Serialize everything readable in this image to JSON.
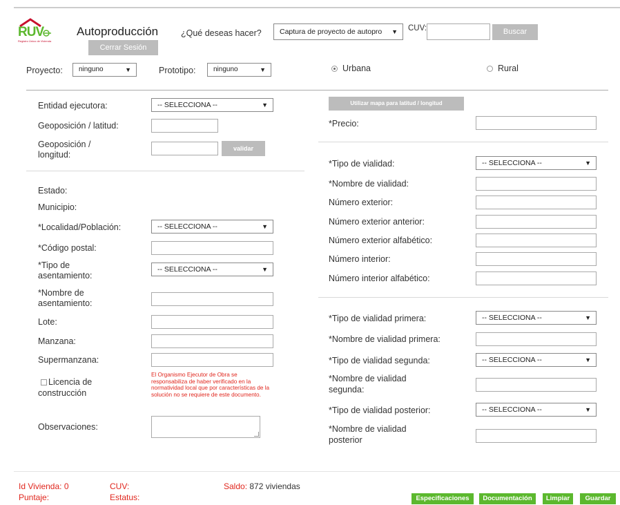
{
  "header": {
    "logo_text": "RUV",
    "logo_subtitle": "Registro Único de Vivienda",
    "title": "Autoproducción",
    "question": "¿Qué deseas hacer?",
    "action_select": "Captura de proyecto de autopro",
    "cuv_label": "CUV:",
    "cuv_value": "",
    "buscar": "Buscar",
    "cerrar_sesion": "Cerrar Sesión"
  },
  "filters": {
    "proyecto_label": "Proyecto:",
    "proyecto_value": "ninguno",
    "prototipo_label": "Prototipo:",
    "prototipo_value": "ninguno",
    "urbana": "Urbana",
    "rural": "Rural"
  },
  "left": {
    "entidad_label": "Entidad ejecutora:",
    "entidad_value": "-- SELECCIONA --",
    "latitud_label": "Geoposición / latitud:",
    "longitud_label_1": "Geoposición /",
    "longitud_label_2": "longitud:",
    "validar": "validar",
    "estado_label": "Estado:",
    "municipio_label": "Municipio:",
    "localidad_label": "*Localidad/Población:",
    "localidad_value": "-- SELECCIONA --",
    "cp_label": "*Código postal:",
    "tipo_asent_label_1": "*Tipo de",
    "tipo_asent_label_2": "asentamiento:",
    "tipo_asent_value": "-- SELECCIONA --",
    "nombre_asent_label_1": "*Nombre de",
    "nombre_asent_label_2": "asentamiento:",
    "lote_label": "Lote:",
    "manzana_label": "Manzana:",
    "supermanzana_label": "Supermanzana:",
    "licencia_label_1": "Licencia de",
    "licencia_label_2": "construcción",
    "licencia_note": [
      "El Organismo Ejecutor de Obra se",
      "responsabiliza de haber verificado en la",
      "normatividad local que por características de la",
      "solución no se requiere de este documento."
    ],
    "observaciones_label": "Observaciones:"
  },
  "right": {
    "mapa_button": "Utilizar mapa para latitud / longitud",
    "precio_label": "*Precio:",
    "tipo_vialidad_label": "*Tipo de vialidad:",
    "tipo_vialidad_value": "-- SELECCIONA --",
    "nombre_vialidad_label": "*Nombre de vialidad:",
    "num_ext_label": "Número exterior:",
    "num_ext_ant_label": "Número exterior anterior:",
    "num_ext_alf_label": "Número exterior alfabético:",
    "num_int_label": "Número interior:",
    "num_int_alf_label": "Número interior alfabético:",
    "tipo_primera_label": "*Tipo de vialidad primera:",
    "tipo_primera_value": "-- SELECCIONA --",
    "nombre_primera_label": "*Nombre de vialidad primera:",
    "tipo_segunda_label": "*Tipo de vialidad segunda:",
    "tipo_segunda_value": "-- SELECCIONA --",
    "nombre_segunda_label_1": "*Nombre de vialidad",
    "nombre_segunda_label_2": "segunda:",
    "tipo_posterior_label": "*Tipo de vialidad posterior:",
    "tipo_posterior_value": "-- SELECCIONA --",
    "nombre_posterior_label_1": "*Nombre de vialidad",
    "nombre_posterior_label_2": "posterior"
  },
  "footer": {
    "id_vivienda_label": "Id Vivienda:",
    "id_vivienda_value": "0",
    "cuv_label": "CUV:",
    "saldo_label": "Saldo:",
    "saldo_value": "872 viviendas",
    "puntaje_label": "Puntaje:",
    "estatus_label": "Estatus:",
    "especificaciones": "Especificaciones",
    "documentacion": "Documentación",
    "limpiar": "Limpiar",
    "guardar": "Guardar"
  },
  "colors": {
    "brand_red": "#c8102e",
    "brand_green": "#5cb82e",
    "button_gray": "#bcbcbc",
    "label_red": "#e0261d"
  }
}
